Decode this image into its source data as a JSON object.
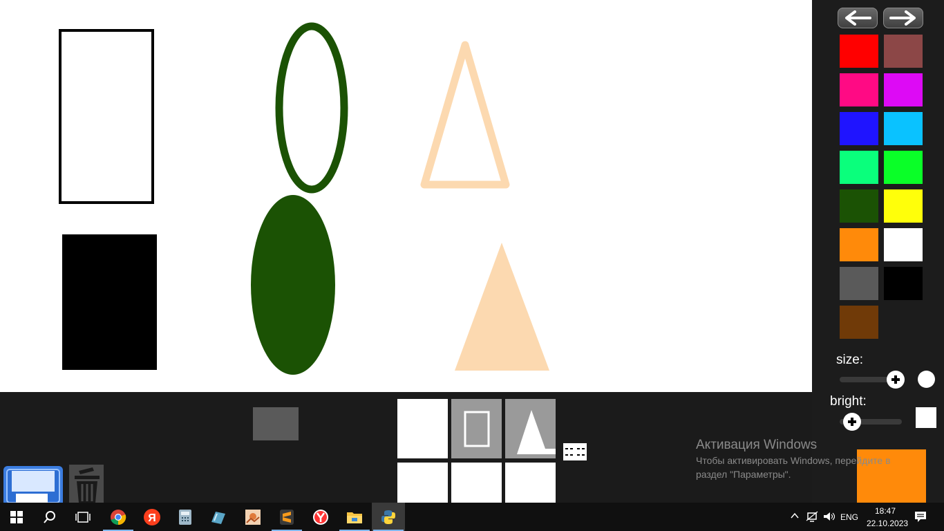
{
  "canvas": {
    "shapes": [
      {
        "name": "outlined-rectangle",
        "kind": "rect",
        "fill": "none",
        "stroke": "#000000"
      },
      {
        "name": "outlined-ellipse",
        "kind": "ellipse",
        "fill": "none",
        "stroke": "#1b5204"
      },
      {
        "name": "outlined-triangle",
        "kind": "triangle",
        "fill": "none",
        "stroke": "#fcd9b0"
      },
      {
        "name": "filled-rectangle",
        "kind": "rect",
        "fill": "#000000",
        "stroke": "none"
      },
      {
        "name": "filled-ellipse",
        "kind": "ellipse",
        "fill": "#1b5204",
        "stroke": "none"
      },
      {
        "name": "filled-triangle",
        "kind": "triangle",
        "fill": "#fcd9b0",
        "stroke": "none"
      }
    ]
  },
  "palette": {
    "nav": {
      "back_icon": "arrow-left-icon",
      "forward_icon": "arrow-right-icon"
    },
    "colors": [
      "#ff0000",
      "#8c4747",
      "#ff0a84",
      "#dd0af5",
      "#1f14ff",
      "#0ac2ff",
      "#0aff7c",
      "#0aff28",
      "#1b5204",
      "#ffff0a",
      "#ff8a0a",
      "#ffffff",
      "#5a5a5a",
      "#000000",
      "#703a08"
    ]
  },
  "controls": {
    "size_label": "size:",
    "size_value": 0.9,
    "bright_label": "bright:",
    "bright_value": 0.2,
    "preview_color": "#ffffff"
  },
  "current_color": "#ff8a0a",
  "tools": {
    "shape_preview_color": "#5a5a5a",
    "grid": [
      {
        "name": "tool-blank-1",
        "state": "idle"
      },
      {
        "name": "tool-rectangle",
        "state": "selected"
      },
      {
        "name": "tool-triangle",
        "state": "selected"
      },
      {
        "name": "tool-blank-2",
        "state": "idle"
      },
      {
        "name": "tool-blank-3",
        "state": "idle"
      },
      {
        "name": "tool-blank-4",
        "state": "idle"
      }
    ],
    "save_icon": "floppy-disk-icon",
    "trash_icon": "trash-can-icon"
  },
  "watermark": {
    "title": "Активация Windows",
    "line1": "Чтобы активировать Windows, перейдите в",
    "line2": "раздел \"Параметры\"."
  },
  "taskbar": {
    "apps": [
      "start-icon",
      "search-icon",
      "task-view-icon",
      "chrome-icon",
      "yandex-icon",
      "calculator-icon",
      "notes-icon",
      "image-viewer-icon",
      "sublime-text-icon",
      "yandex-browser-icon",
      "file-explorer-icon",
      "python-icon"
    ],
    "tray": {
      "lang": "ENG",
      "time": "18:47",
      "date": "22.10.2023"
    }
  }
}
